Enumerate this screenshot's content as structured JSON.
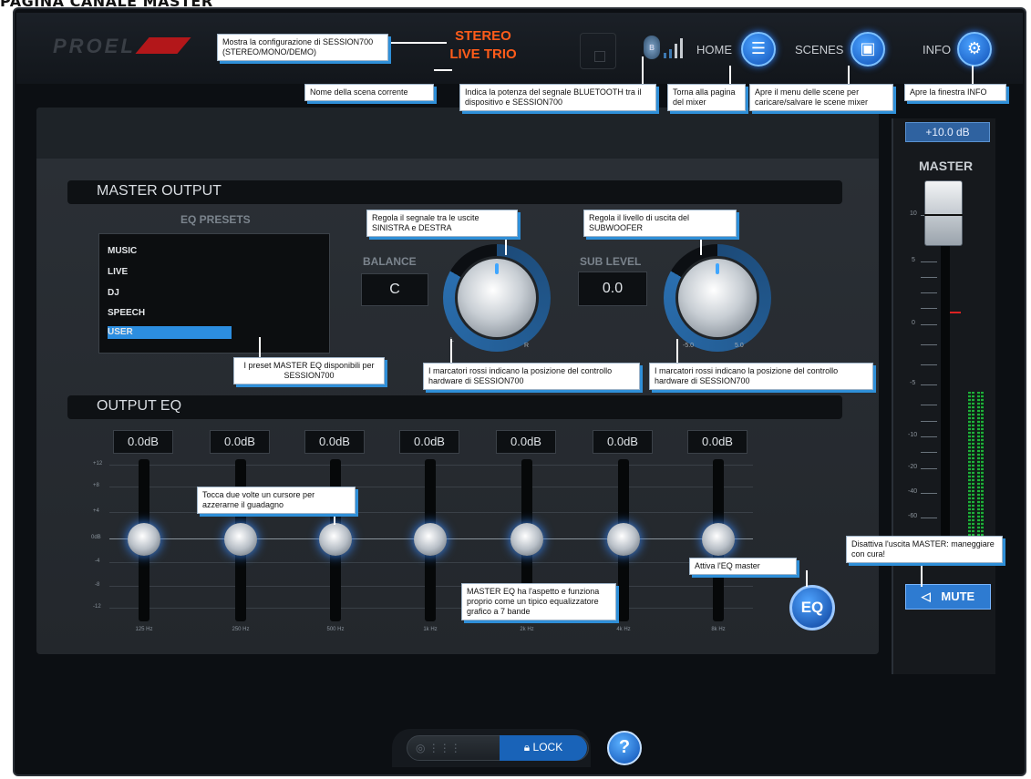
{
  "page_heading": "PAGINA CANALE MASTER",
  "topbar": {
    "logo": "PROEL",
    "stereo_line1": "STEREO",
    "stereo_line2": "LIVE TRIO",
    "home_label": "HOME",
    "scenes_label": "SCENES",
    "info_label": "INFO"
  },
  "callouts": {
    "config": "Mostra la configurazione di SESSION700 (STEREO/MONO/DEMO)",
    "scene_name": "Nome della scena corrente",
    "bluetooth": "Indica la potenza del segnale BLUETOOTH tra il dispositivo e SESSION700",
    "home": "Torna alla pagina del mixer",
    "scenes": "Apre il menu delle scene per caricare/salvare le scene mixer",
    "info": "Apre la finestra INFO",
    "balance": "Regola il segnale tra le uscite SINISTRA e DESTRA",
    "sub": "Regola il livello di uscita del SUBWOOFER",
    "presets": "I preset MASTER EQ disponibili per SESSION700",
    "markers_left": "I marcatori rossi indicano la posizione del controllo hardware di SESSION700",
    "markers_right": "I marcatori rossi indicano la posizione del controllo hardware di SESSION700",
    "double_tap": "Tocca due volte un cursore per azzerarne il guadagno",
    "eq_enable": "Attiva l'EQ master",
    "eq_desc": "MASTER EQ ha l'aspetto e funziona proprio come un tipico equalizzatore grafico a 7 bande",
    "mute": "Disattiva l'uscita MASTER: maneggiare con cura!"
  },
  "master_output": {
    "title": "MASTER OUTPUT",
    "eq_presets_label": "EQ PRESETS",
    "presets": [
      "MUSIC",
      "LIVE",
      "DJ",
      "SPEECH",
      "USER"
    ],
    "selected_preset": "USER",
    "balance_label": "BALANCE",
    "balance_value": "C",
    "balance_left": "L",
    "balance_right": "R",
    "sub_label": "SUB LEVEL",
    "sub_value": "0.0",
    "sub_min": "-5.0",
    "sub_max": "5.0"
  },
  "output_eq": {
    "title": "OUTPUT EQ",
    "scale": [
      "+12",
      "+8",
      "+4",
      "0dB",
      "-4",
      "-8",
      "-12"
    ],
    "bands": [
      {
        "freq": "125 Hz",
        "gain": "0.0dB"
      },
      {
        "freq": "250 Hz",
        "gain": "0.0dB"
      },
      {
        "freq": "500 Hz",
        "gain": "0.0dB"
      },
      {
        "freq": "1k Hz",
        "gain": "0.0dB"
      },
      {
        "freq": "2k Hz",
        "gain": "0.0dB"
      },
      {
        "freq": "4k Hz",
        "gain": "0.0dB"
      },
      {
        "freq": "8k Hz",
        "gain": "0.0dB"
      }
    ],
    "eq_button": "EQ"
  },
  "master": {
    "db_readout": "+10.0 dB",
    "title": "MASTER",
    "scale": [
      "10",
      "5",
      "0",
      "-5",
      "-10",
      "-20",
      "-40",
      "-60"
    ],
    "mute_label": "MUTE"
  },
  "bottom": {
    "lock_label": "LOCK",
    "help_label": "?"
  }
}
